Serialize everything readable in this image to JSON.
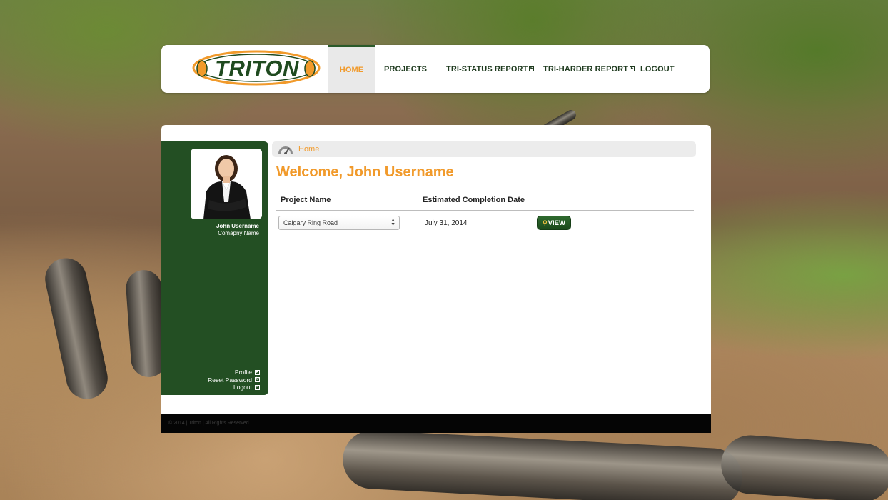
{
  "brand": {
    "name": "TRITON"
  },
  "nav": {
    "items": [
      {
        "label": "HOME",
        "active": true,
        "external": false
      },
      {
        "label": "PROJECTS",
        "active": false,
        "external": false
      },
      {
        "label": "TRI-STATUS REPORT",
        "active": false,
        "external": true
      },
      {
        "label": "TRI-HARDER REPORT",
        "active": false,
        "external": true
      },
      {
        "label": "LOGOUT",
        "active": false,
        "external": false
      }
    ]
  },
  "sidebar": {
    "user_name": "John Username",
    "company_name": "Comapny Name",
    "links": [
      {
        "label": "Profile",
        "icon": "external-icon"
      },
      {
        "label": "Reset Password",
        "icon": "reset-icon"
      },
      {
        "label": "Logout",
        "icon": "close-box-icon"
      }
    ]
  },
  "breadcrumb": {
    "label": "Home",
    "icon": "dashboard-gauge-icon"
  },
  "main": {
    "welcome": "Welcome, John Username",
    "table": {
      "headers": [
        "Project Name",
        "Estimated Completion Date"
      ],
      "rows": [
        {
          "project": "Calgary Ring Road",
          "date": "July 31, 2014",
          "action": "VIEW"
        }
      ]
    }
  },
  "footer": {
    "text": "© 2014 | Triton | All Rights Reserved |"
  },
  "colors": {
    "accent": "#f19a2b",
    "brand_green": "#234f23",
    "footer_bg": "#050505"
  }
}
